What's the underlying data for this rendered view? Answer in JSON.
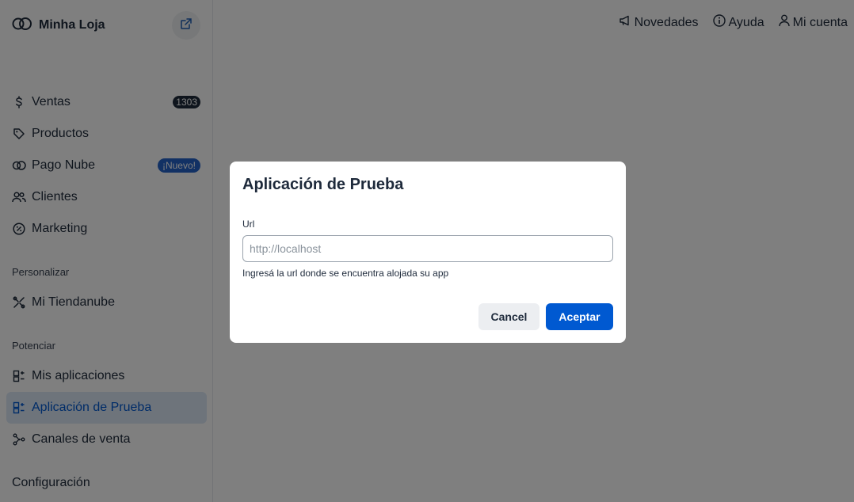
{
  "brand": {
    "name": "Minha Loja",
    "logo_icon": "cloud-logo-icon",
    "external_icon": "external-link-icon"
  },
  "sidebar": {
    "items": [
      {
        "label": "Ventas",
        "icon": "dollar-icon",
        "badge": "1303"
      },
      {
        "label": "Productos",
        "icon": "tag-icon"
      },
      {
        "label": "Pago Nube",
        "icon": "cloud-icon",
        "badge": "¡Nuevo!"
      },
      {
        "label": "Clientes",
        "icon": "users-icon"
      },
      {
        "label": "Marketing",
        "icon": "percent-icon"
      }
    ],
    "section_personalizar": "Personalizar",
    "personalizar_items": [
      {
        "label": "Mi Tiendanube",
        "icon": "tools-icon"
      }
    ],
    "section_potenciar": "Potenciar",
    "potenciar_items": [
      {
        "label": "Mis aplicaciones",
        "icon": "apps-icon"
      },
      {
        "label": "Aplicación de Prueba",
        "icon": "apps-icon",
        "active": true
      },
      {
        "label": "Canales de venta",
        "icon": "share-icon"
      }
    ],
    "config_label": "Configuración"
  },
  "topbar": {
    "news": "Novedades",
    "help": "Ayuda",
    "account": "Mi cuenta"
  },
  "modal": {
    "title": "Aplicación de Prueba",
    "field_label": "Url",
    "input_value": "",
    "input_placeholder": "http://localhost",
    "help_text": "Ingresá la url donde se encuentra alojada su app",
    "cancel_label": "Cancel",
    "accept_label": "Aceptar"
  },
  "colors": {
    "accent": "#0059d1",
    "active_bg": "#dde8f7",
    "overlay": "rgba(0,0,0,0.5)",
    "text": "#1e2a3b"
  }
}
